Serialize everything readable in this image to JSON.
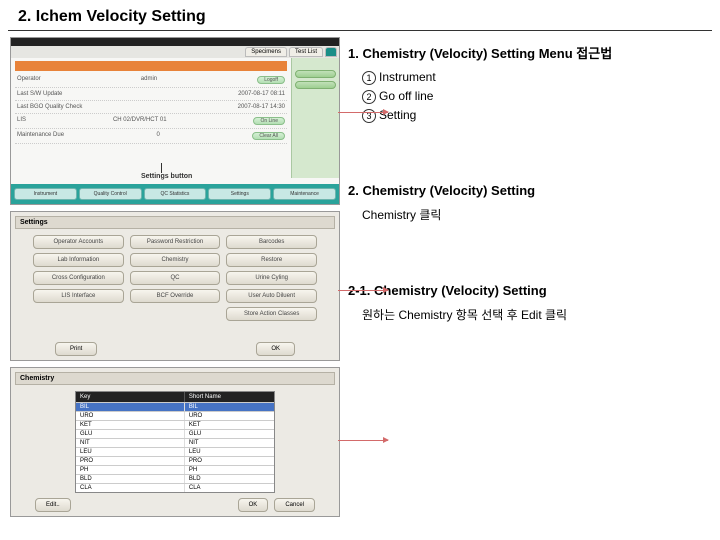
{
  "title": "2. Ichem Velocity Setting",
  "panel1": {
    "tabs": [
      "Specimens",
      "Test List",
      "    "
    ],
    "rows": [
      {
        "l": "Operator",
        "r": "admin"
      },
      {
        "l": "Last S/W Update",
        "r": "2007-08-17 08:11"
      },
      {
        "l": "Last BGO Quality Check",
        "r": "2007-08-17 14:30"
      },
      {
        "l": "LIS",
        "r": "CH 02/DVR/HCT 01"
      },
      {
        "l": "Maintenance Due",
        "r": "0"
      }
    ],
    "sideBtns": [
      "",
      ""
    ],
    "rowBtns": [
      "Logoff",
      "On Line"
    ],
    "clear": "Clear All",
    "footer": [
      "Instrument",
      "Quality Control",
      "QC Statistics",
      "Settings",
      "Maintenance"
    ],
    "annot": "Settings button"
  },
  "panel2": {
    "header": "Settings",
    "buttons": [
      "Operator Accounts",
      "Password Restriction",
      "Barcodes",
      "Lab Information",
      "Chemistry",
      "Restore",
      "Cross Configuration",
      "QC",
      "Urine Cyling",
      "LIS Interface",
      "BCF Override",
      "User Auto Diluent",
      "",
      "",
      "Store Action Classes"
    ],
    "footer": {
      "print": "Print",
      "ok": "OK"
    }
  },
  "panel3": {
    "header": "Chemistry",
    "thead": {
      "c1": "Key",
      "c2": "Short Name"
    },
    "rows": [
      {
        "k": "BIL",
        "v": "BIL",
        "sel": true
      },
      {
        "k": "URO",
        "v": "URO"
      },
      {
        "k": "KET",
        "v": "KET"
      },
      {
        "k": "GLU",
        "v": "GLU"
      },
      {
        "k": "NIT",
        "v": "NIT"
      },
      {
        "k": "LEU",
        "v": "LEU"
      },
      {
        "k": "PRO",
        "v": "PRO"
      },
      {
        "k": "PH",
        "v": "PH"
      },
      {
        "k": "BLD",
        "v": "BLD"
      },
      {
        "k": "CLA",
        "v": "CLA"
      }
    ],
    "footer": {
      "edit": "Edit..",
      "ok": "OK",
      "cancel": "Cancel"
    }
  },
  "right": {
    "sec1": {
      "title": "1. Chemistry (Velocity) Setting Menu 접근법",
      "items": [
        {
          "n": "1",
          "t": "Instrument"
        },
        {
          "n": "2",
          "t": "Go off line"
        },
        {
          "n": "3",
          "t": "Setting"
        }
      ]
    },
    "sec2": {
      "title": "2. Chemistry (Velocity) Setting",
      "line": "Chemistry 클릭"
    },
    "sec3": {
      "title": "2-1. Chemistry (Velocity) Setting",
      "line": "원하는 Chemistry 항목 선택 후  Edit 클릭"
    }
  }
}
